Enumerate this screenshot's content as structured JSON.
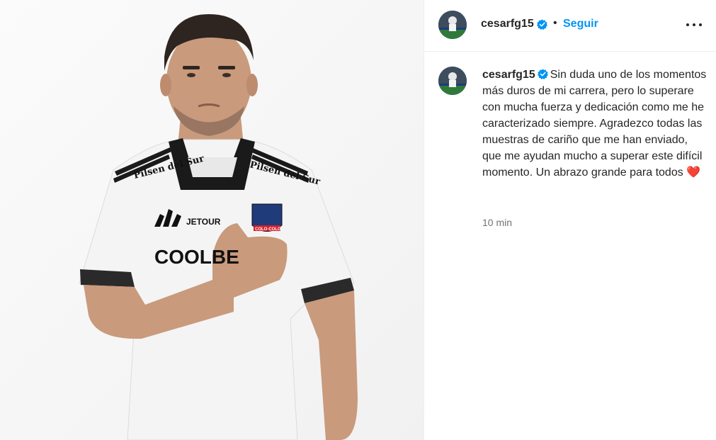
{
  "post": {
    "username": "cesarfg15",
    "follow_label": "Seguir",
    "separator": "•",
    "caption_text": "Sin duda uno de los momentos más duros de mi carrera, pero lo superare con mucha fuerza y dedicación como me he caracterizado siempre. Agradezco todas las muestras de cariño que me han enviado, que me ayudan mucho a superar este difícil momento. Un abrazo grande para todos",
    "caption_emoji": "❤️",
    "timestamp": "10 min"
  },
  "photo": {
    "sponsor_chest": "COOLBE",
    "sponsor_logo": "JETOUR",
    "sponsor_shoulder": "Pilsen del Sur",
    "crest_text": "COLO-COLO"
  },
  "colors": {
    "link_blue": "#0095f6",
    "verified_blue": "#0095f6",
    "text": "#262626",
    "secondary": "#737373",
    "border": "#efefef"
  },
  "icons": {
    "verified": "verified-badge-icon",
    "more": "more-options-icon"
  }
}
